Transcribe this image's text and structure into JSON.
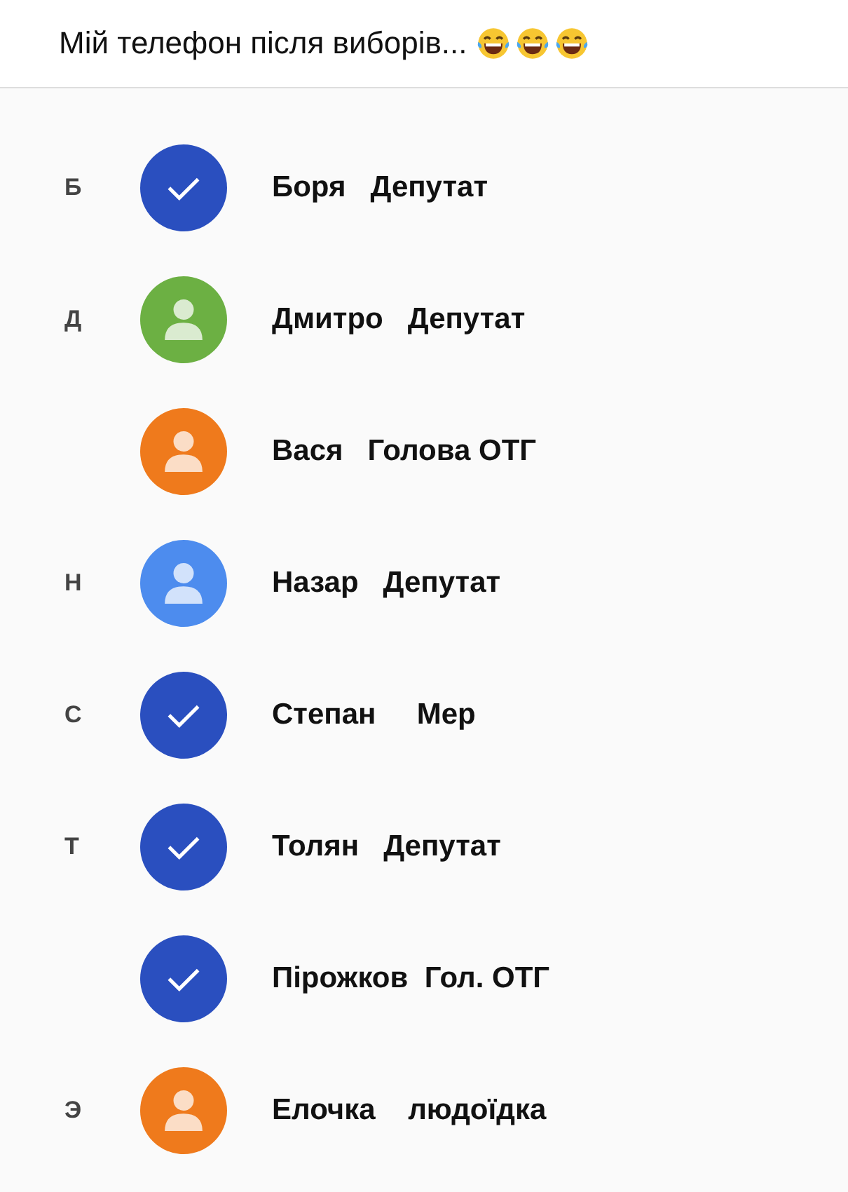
{
  "caption": {
    "text": "Мій телефон після виборів...",
    "emojis": [
      {
        "kind": "laughing"
      },
      {
        "kind": "laughing"
      },
      {
        "kind": "laughing"
      }
    ]
  },
  "contacts": [
    {
      "letter": "Б",
      "name": "Боря   Депутат",
      "selected": true,
      "color": "#2a4fbf"
    },
    {
      "letter": "Д",
      "name": "Дмитро   Депутат",
      "selected": false,
      "color": "#6cb043"
    },
    {
      "name": "Вася   Голова ОТГ",
      "selected": false,
      "color": "#ef7a1c"
    },
    {
      "letter": "Н",
      "name": "Назар   Депутат",
      "selected": false,
      "color": "#4d8cee"
    },
    {
      "letter": "С",
      "name": "Степан     Мер",
      "selected": true,
      "color": "#2a4fbf"
    },
    {
      "letter": "Т",
      "name": "Толян   Депутат",
      "selected": true,
      "color": "#2a4fbf"
    },
    {
      "name": "Пірожков  Гол. ОТГ",
      "selected": true,
      "color": "#2a4fbf"
    },
    {
      "letter": "Э",
      "name": "Елочка    людоїдка",
      "selected": false,
      "color": "#ef7a1c"
    }
  ]
}
